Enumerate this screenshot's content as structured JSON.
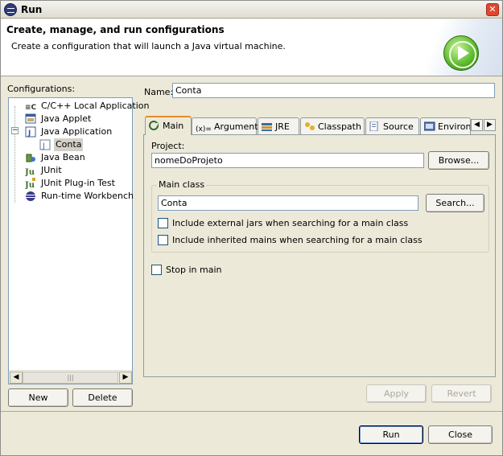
{
  "window": {
    "title": "Run"
  },
  "banner": {
    "title": "Create, manage, and run configurations",
    "description": "Create a configuration that will launch a Java virtual machine."
  },
  "configurations": {
    "label": "Configurations:",
    "tree": [
      {
        "label": "C/C++ Local Application",
        "icon": "cpp-icon"
      },
      {
        "label": "Java Applet",
        "icon": "applet-icon"
      },
      {
        "label": "Java Application",
        "icon": "java-app-icon",
        "expanded": true
      },
      {
        "label": "Conta",
        "icon": "java-config-icon",
        "selected": true
      },
      {
        "label": "Java Bean",
        "icon": "bean-icon"
      },
      {
        "label": "JUnit",
        "icon": "junit-icon"
      },
      {
        "label": "JUnit Plug-in Test",
        "icon": "junit-plugin-icon"
      },
      {
        "label": "Run-time Workbench",
        "icon": "workbench-icon"
      }
    ],
    "new_label": "New",
    "delete_label": "Delete"
  },
  "name": {
    "label": "Name:",
    "value": "Conta"
  },
  "tabs": [
    {
      "label": "Main",
      "icon": "main-tab-icon",
      "active": true
    },
    {
      "label": "Arguments",
      "icon": "arguments-icon"
    },
    {
      "label": "JRE",
      "icon": "jre-icon"
    },
    {
      "label": "Classpath",
      "icon": "classpath-icon"
    },
    {
      "label": "Source",
      "icon": "source-icon"
    },
    {
      "label": "Environment",
      "icon": "environment-icon"
    }
  ],
  "main_tab": {
    "project_label": "Project:",
    "project_value": "nomeDoProjeto",
    "browse_label": "Browse...",
    "main_class_group": "Main class",
    "main_class_value": "Conta",
    "search_label": "Search...",
    "include_external_jars": {
      "label": "Include external jars when searching for a main class",
      "checked": false
    },
    "include_inherited_mains": {
      "label": "Include inherited mains when searching for a main class",
      "checked": false
    },
    "stop_in_main": {
      "label": "Stop in main",
      "checked": false
    }
  },
  "actions": {
    "apply_label": "Apply",
    "revert_label": "Revert",
    "run_label": "Run",
    "close_label": "Close"
  },
  "colors": {
    "accent_tab": "#e68b2c",
    "run_badge": "#5dbb2e",
    "title_close": "#e0462f"
  }
}
